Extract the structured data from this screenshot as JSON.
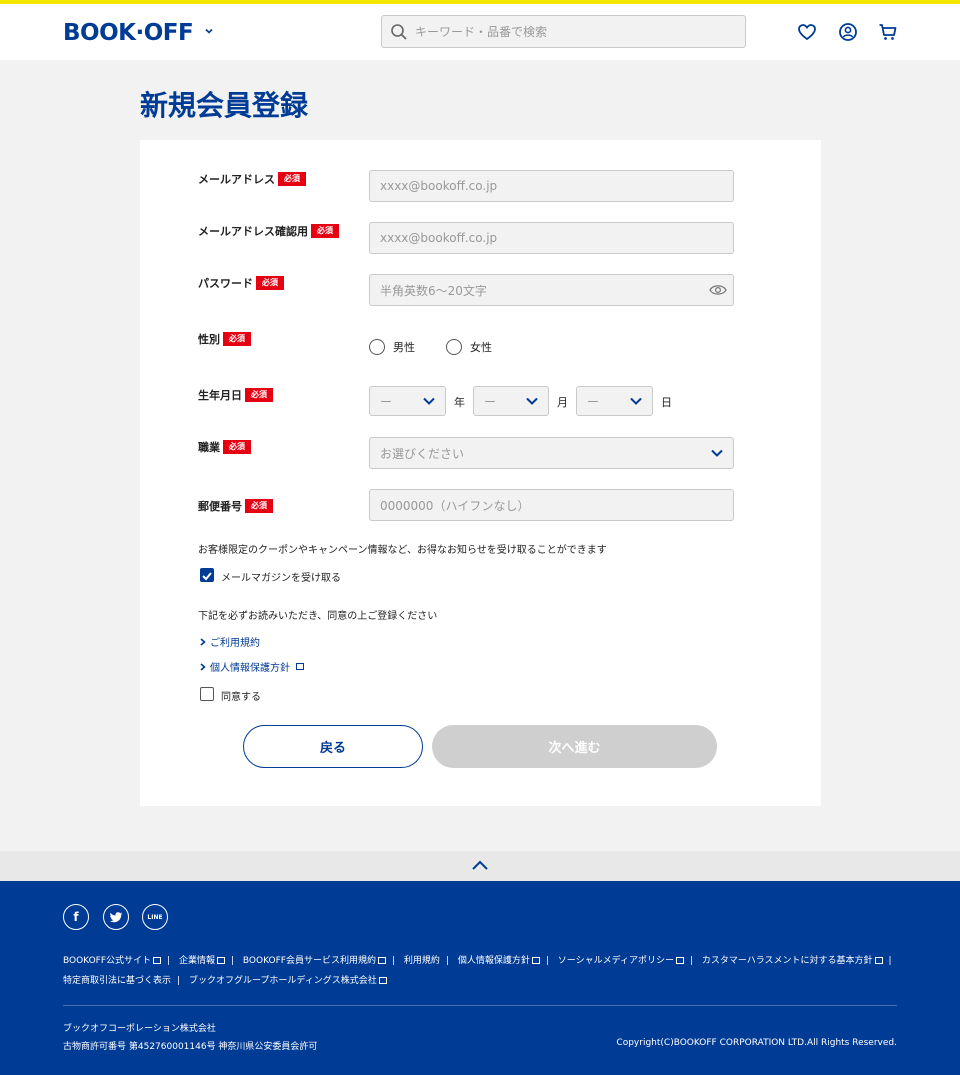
{
  "header": {
    "logo": "BOOK·OFF",
    "search_placeholder": "キーワード・品番で検索",
    "icons": [
      "chevron-down-icon",
      "search-icon",
      "heart-icon",
      "user-icon",
      "cart-icon"
    ]
  },
  "page": {
    "title": "新規会員登録"
  },
  "form": {
    "required_badge": "必須",
    "email": {
      "label": "メールアドレス",
      "placeholder": "xxxx@bookoff.co.jp"
    },
    "email_confirm": {
      "label": "メールアドレス確認用",
      "placeholder": "xxxx@bookoff.co.jp"
    },
    "password": {
      "label": "パスワード",
      "placeholder": "半角英数6～20文字"
    },
    "gender": {
      "label": "性別",
      "options": [
        "男性",
        "女性"
      ]
    },
    "birthday": {
      "label": "生年月日",
      "year_value": "ー",
      "month_value": "ー",
      "day_value": "ー",
      "year_unit": "年",
      "month_unit": "月",
      "day_unit": "日"
    },
    "occupation": {
      "label": "職業",
      "value": "お選びください"
    },
    "zip": {
      "label": "郵便番号",
      "placeholder": "0000000（ハイフンなし）"
    },
    "newsletter_note": "お客様限定のクーポンやキャンペーン情報など、お得なお知らせを受け取ることができます",
    "newsletter_label": "メールマガジンを受け取る",
    "newsletter_checked": true,
    "agree_note": "下記を必ずお読みいただき、同意の上ご登録ください",
    "links": [
      "ご利用規約",
      "個人情報保護方針"
    ],
    "agree_label": "同意する",
    "agree_checked": false,
    "back_button": "戻る",
    "next_button": "次へ進む"
  },
  "footer": {
    "social": [
      "f",
      "t",
      "LINE"
    ],
    "links": [
      "BOOKOFF公式サイト",
      "企業情報",
      "BOOKOFF会員サービス利用規約",
      "利用規約",
      "個人情報保護方針",
      "ソーシャルメディアポリシー",
      "カスタマーハラスメントに対する基本方針",
      "特定商取引法に基づく表示",
      "ブックオフグループホールディングス株式会社"
    ],
    "company": "ブックオフコーポレーション株式会社",
    "license": "古物商許可番号 第452760001146号 神奈川県公安委員会許可",
    "copyright": "Copyright(C)BOOKOFF CORPORATION LTD.All Rights Reserved."
  },
  "colors": {
    "brand": "#003b95",
    "required": "#e60012",
    "topbar": "#f5e600"
  }
}
